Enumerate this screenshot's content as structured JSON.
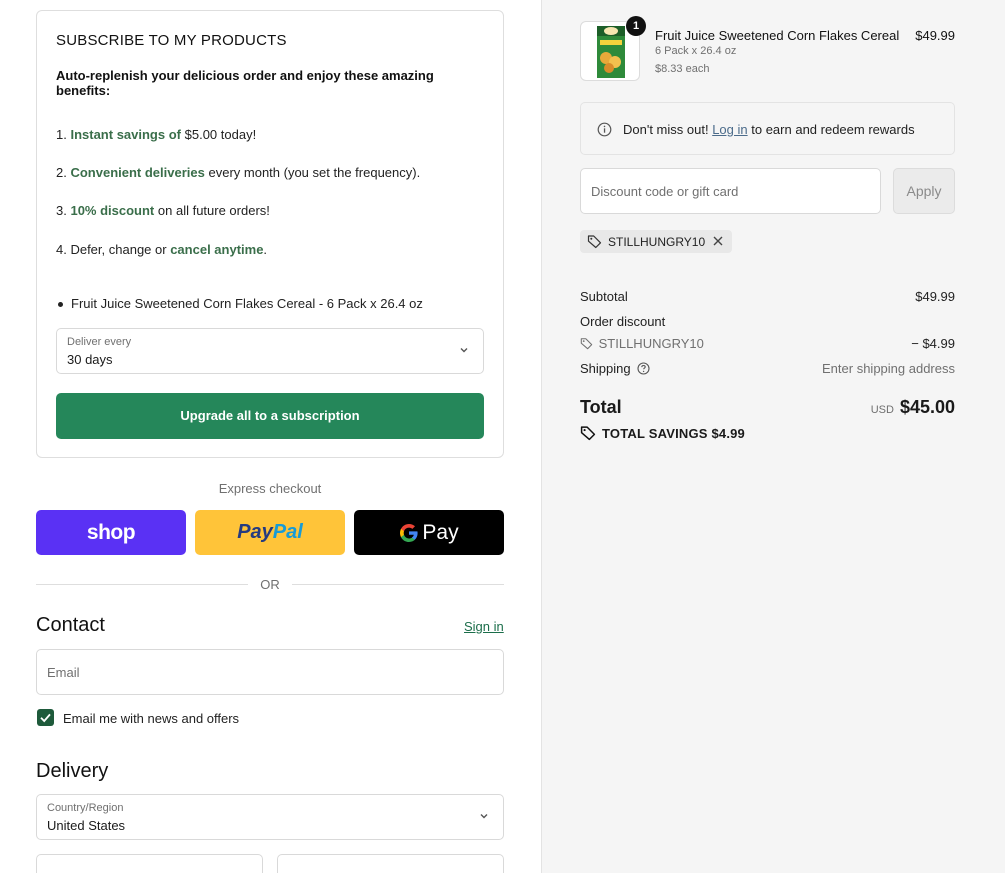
{
  "subscription": {
    "title": "SUBSCRIBE TO MY PRODUCTS",
    "intro": "Auto-replenish your delicious order and enjoy these amazing benefits:",
    "b1_num": "1.",
    "b1_hl": "Instant savings of",
    "b1_rest": "$5.00 today!",
    "b2_num": "2.",
    "b2_hl": "Convenient deliveries",
    "b2_rest": "every month (you set the frequency).",
    "b3_num": "3.",
    "b3_hl": "10% discount",
    "b3_rest": "on all future orders!",
    "b4_pre": "4. Defer, change or",
    "b4_hl": "cancel anytime",
    "b4_post": ".",
    "product_item": "Fruit Juice Sweetened Corn Flakes Cereal - 6 Pack x 26.4 oz",
    "deliver_label": "Deliver every",
    "deliver_value": "30 days",
    "upgrade_button": "Upgrade all to a subscription"
  },
  "express": {
    "label": "Express checkout",
    "shop": "shop",
    "paypal_1": "Pay",
    "paypal_2": "Pal",
    "gpay": "Pay",
    "or": "OR"
  },
  "contact": {
    "heading": "Contact",
    "sign_in": "Sign in",
    "email_placeholder": "Email",
    "news_label": "Email me with news and offers"
  },
  "delivery": {
    "heading": "Delivery",
    "country_label": "Country/Region",
    "country_value": "United States"
  },
  "cart": {
    "quantity": "1",
    "product_name": "Fruit Juice Sweetened Corn Flakes Cereal",
    "variant": "6 Pack x 26.4 oz",
    "unit_price": "$8.33 each",
    "price": "$49.99"
  },
  "rewards": {
    "pre": "Don't miss out!",
    "link": "Log in",
    "post": "to earn and redeem rewards"
  },
  "discount": {
    "placeholder": "Discount code or gift card",
    "apply": "Apply",
    "applied_code": "STILLHUNGRY10"
  },
  "summary": {
    "subtotal_label": "Subtotal",
    "subtotal_value": "$49.99",
    "order_discount_label": "Order discount",
    "discount_code": "STILLHUNGRY10",
    "discount_value": "− $4.99",
    "shipping_label": "Shipping",
    "shipping_value": "Enter shipping address",
    "total_label": "Total",
    "currency": "USD",
    "total_value": "$45.00",
    "savings": "TOTAL SAVINGS $4.99"
  },
  "colors": {
    "accent_green": "#25875a",
    "shop_purple": "#5a31f4",
    "paypal_yellow": "#ffc439"
  }
}
